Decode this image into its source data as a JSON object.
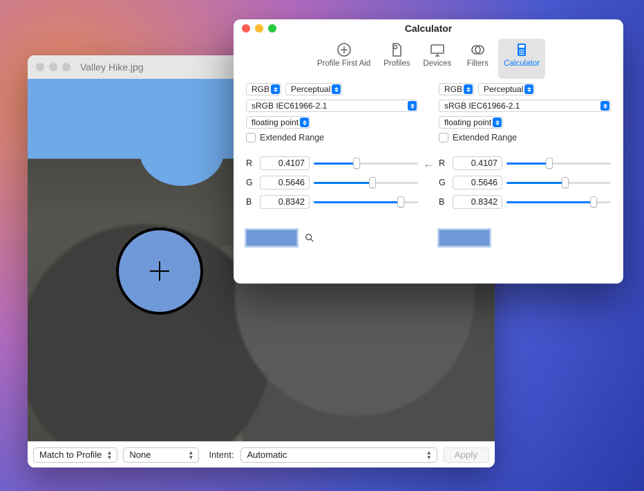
{
  "image_window": {
    "title": "Valley Hike.jpg",
    "footer": {
      "mode": "Match to Profile",
      "profile": "None",
      "intent_label": "Intent:",
      "intent_value": "Automatic",
      "apply": "Apply"
    }
  },
  "calc_window": {
    "title": "Calculator",
    "toolbar": [
      {
        "id": "profile-first-aid",
        "label": "Profile First Aid"
      },
      {
        "id": "profiles",
        "label": "Profiles"
      },
      {
        "id": "devices",
        "label": "Devices"
      },
      {
        "id": "filters",
        "label": "Filters"
      },
      {
        "id": "calculator",
        "label": "Calculator"
      }
    ],
    "active_tool": "calculator",
    "left": {
      "space": "RGB",
      "intent": "Perceptual",
      "profile": "sRGB IEC61966-2.1",
      "format": "floating point",
      "extended_label": "Extended Range",
      "channels": [
        {
          "label": "R",
          "value": "0.4107",
          "pct": 41.07
        },
        {
          "label": "G",
          "value": "0.5646",
          "pct": 56.46
        },
        {
          "label": "B",
          "value": "0.8342",
          "pct": 83.42
        }
      ],
      "swatch": "#6f99d8"
    },
    "direction": "←",
    "right": {
      "space": "RGB",
      "intent": "Perceptual",
      "profile": "sRGB IEC61966-2.1",
      "format": "floating point",
      "extended_label": "Extended Range",
      "channels": [
        {
          "label": "R",
          "value": "0.4107",
          "pct": 41.07
        },
        {
          "label": "G",
          "value": "0.5646",
          "pct": 56.46
        },
        {
          "label": "B",
          "value": "0.8342",
          "pct": 83.42
        }
      ],
      "swatch": "#6f99d8"
    }
  }
}
